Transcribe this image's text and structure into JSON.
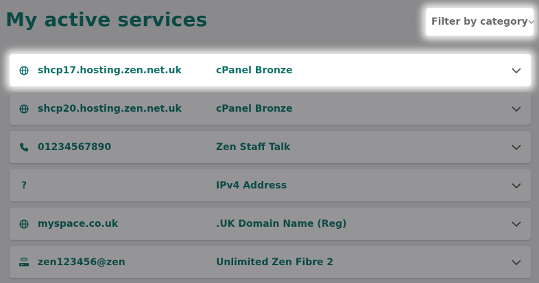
{
  "page": {
    "title": "My active services"
  },
  "filter": {
    "label": "Filter by category",
    "icon": "chevron-down-icon"
  },
  "services": [
    {
      "icon": "globe-icon",
      "name": "shcp17.hosting.zen.net.uk",
      "product": "cPanel Bronze",
      "highlighted": true
    },
    {
      "icon": "globe-icon",
      "name": "shcp20.hosting.zen.net.uk",
      "product": "cPanel Bronze",
      "highlighted": false
    },
    {
      "icon": "phone-icon",
      "name": "01234567890",
      "product": "Zen Staff Talk",
      "highlighted": false
    },
    {
      "icon": "question-icon",
      "glyph": "?",
      "name": "",
      "product": "IPv4 Address",
      "highlighted": false
    },
    {
      "icon": "globe-icon",
      "name": "myspace.co.uk",
      "product": ".UK Domain Name (Reg)",
      "highlighted": false
    },
    {
      "icon": "router-icon",
      "name": "zen123456@zen",
      "product": "Unlimited Zen Fibre 2",
      "highlighted": false
    }
  ],
  "colors": {
    "overlay": "#8a8a8c",
    "text_dark_teal": "#0b4a44",
    "text_teal": "#0f7168",
    "highlight_bg": "#ffffff"
  }
}
